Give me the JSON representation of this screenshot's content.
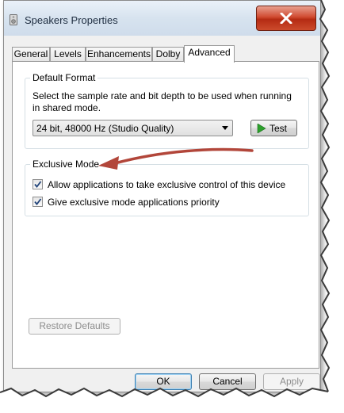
{
  "window": {
    "title": "Speakers Properties",
    "close_icon": "close-icon"
  },
  "tabs": [
    {
      "label": "General"
    },
    {
      "label": "Levels"
    },
    {
      "label": "Enhancements"
    },
    {
      "label": "Dolby"
    },
    {
      "label": "Advanced",
      "active": true
    }
  ],
  "default_format": {
    "legend": "Default Format",
    "description": "Select the sample rate and bit depth to be used when running in shared mode.",
    "description_line1": "Select the sample rate and bit depth to be used when running",
    "description_line2": "in shared mode.",
    "selected_format": "24 bit, 48000 Hz (Studio Quality)",
    "test_label": "Test"
  },
  "exclusive_mode": {
    "legend": "Exclusive Mode",
    "options": [
      {
        "label": "Allow applications to take exclusive control of this device",
        "checked": true
      },
      {
        "label": "Give exclusive mode applications priority",
        "checked": true
      }
    ]
  },
  "restore_defaults_label": "Restore Defaults",
  "footer": {
    "ok_label": "OK",
    "cancel_label": "Cancel",
    "apply_label": "Apply"
  },
  "colors": {
    "close_button": "#c8402a",
    "annotation_arrow": "#b2463a",
    "play_icon": "#2ca02c",
    "focus_border": "#3c7fb1"
  }
}
